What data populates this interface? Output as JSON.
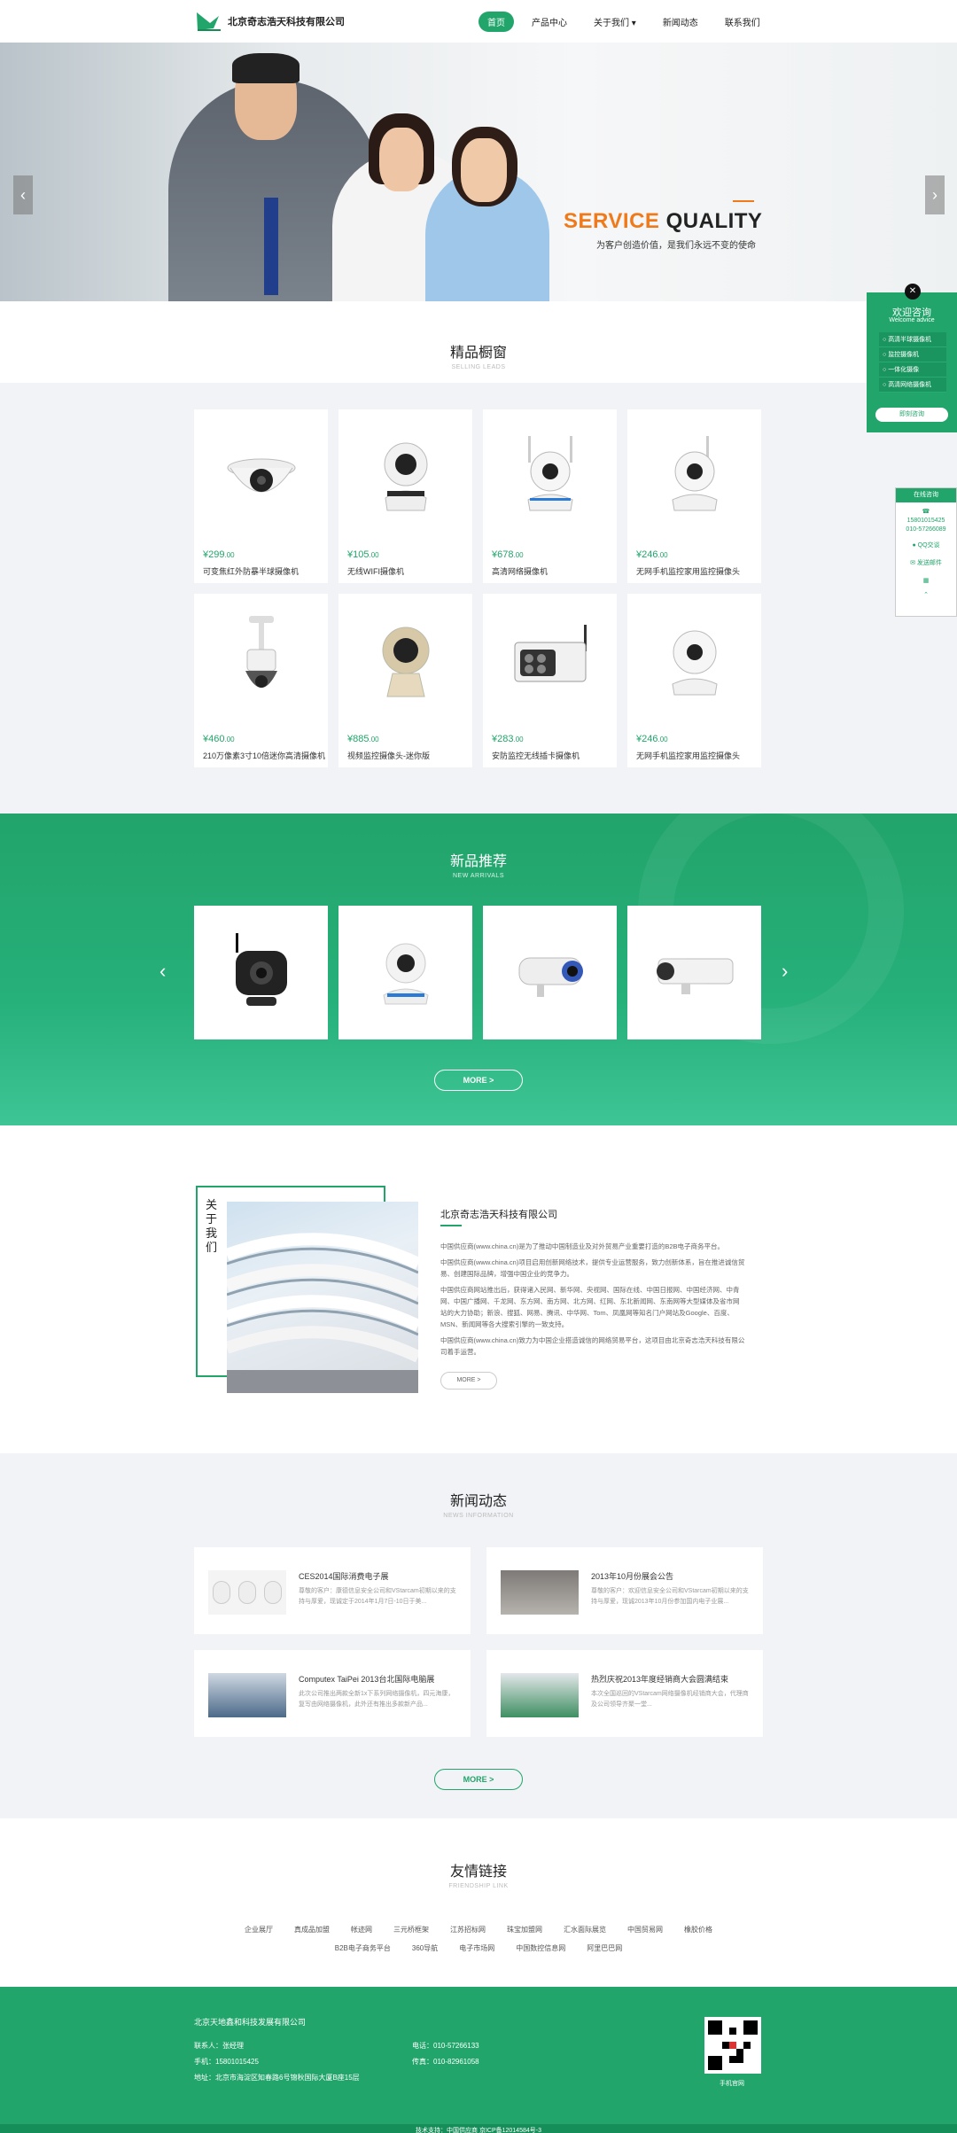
{
  "header": {
    "company": "北京奇志浩天科技有限公司",
    "nav": [
      "首页",
      "产品中心",
      "关于我们",
      "新闻动态",
      "联系我们"
    ],
    "nav_active": 0
  },
  "banner": {
    "title_orange": "SERVICE",
    "title_dark": "QUALITY",
    "subtitle": "为客户创造价值，是我们永远不变的使命"
  },
  "products": {
    "title": "精品橱窗",
    "subtitle": "SELLING LEADS",
    "items": [
      {
        "price": "¥299",
        "cents": ".00",
        "name": "可变焦红外防暴半球摄像机"
      },
      {
        "price": "¥105",
        "cents": ".00",
        "name": "无线WIFI摄像机"
      },
      {
        "price": "¥678",
        "cents": ".00",
        "name": "高清网络摄像机"
      },
      {
        "price": "¥246",
        "cents": ".00",
        "name": "无网手机监控家用监控摄像头"
      },
      {
        "price": "¥460",
        "cents": ".00",
        "name": "210万像素3寸10倍迷你高清摄像机"
      },
      {
        "price": "¥885",
        "cents": ".00",
        "name": "视频监控摄像头-迷你版"
      },
      {
        "price": "¥283",
        "cents": ".00",
        "name": "安防监控无线插卡摄像机"
      },
      {
        "price": "¥246",
        "cents": ".00",
        "name": "无网手机监控家用监控摄像头"
      }
    ]
  },
  "new_arrivals": {
    "title": "新品推荐",
    "subtitle": "NEW ARRIVALS",
    "more": "MORE >"
  },
  "about": {
    "label": "关于我们",
    "company": "北京奇志浩天科技有限公司",
    "paragraphs": [
      "中国供应商(www.china.cn)是为了推动中国制造业及对外贸易产业重要打造的B2B电子商务平台。",
      "中国供应商(www.china.cn)项目启用创新网络技术，提供专业运营服务，致力创新体系，旨在推进诚信贸易、创建国际品牌，增强中国企业的竞争力。",
      "中国供应商网站推出后，获得诸入民网、新华网、央视网、国际在线、中国日报网、中国经济网、中青网、中国广播网、千龙网、东方网、南方网、北方网、红网、东北新闻网、东南网等大型媒体及省市网站的大力协助；新浪、搜狐、网易、腾讯、中华网、Tom、凤凰网等知名门户网站及Google、百度、MSN、新闻网等各大搜索引擎的一致支持。",
      "中国供应商(www.china.cn)致力为中国企业搭造诚信的网络贸易平台，这项目由北京奇志浩天科技有限公司着手运营。"
    ],
    "more": "MORE >"
  },
  "news": {
    "title": "新闻动态",
    "subtitle": "NEWS INFORMATION",
    "items": [
      {
        "title": "CES2014国际消费电子展",
        "desc": "尊敬的客户：康德信息安全公司和VStarcam初期以来的支持与厚爱，现诚定于2014年1月7日-10日于美..."
      },
      {
        "title": "2013年10月份展会公告",
        "desc": "尊敬的客户：欢迎信息安全公司和VStarcam初期以来的支持与厚爱，现诚2013年10月份参加国内电子业展..."
      },
      {
        "title": "Computex TaiPei 2013台北国际电脑展",
        "desc": "此次公司推出两款全新1x下系列网络摄像机，四元海康，复写由网络摄像机，此外还有推出多款新产品..."
      },
      {
        "title": "热烈庆祝2013年度经销商大会圆满结束",
        "desc": "本次全国巡回的VStarcam网络摄像机经销商大会，代理商及公司领导齐聚一堂..."
      }
    ],
    "more": "MORE >"
  },
  "links": {
    "title": "友情链接",
    "subtitle": "FRIENDSHIP LINK",
    "row1": [
      "企业展厅",
      "真成品加盟",
      "帐迹网",
      "三元桥框架",
      "江苏招标网",
      "珠宝加盟网",
      "汇水面际展览",
      "中国贸易网",
      "橡胶价格"
    ],
    "row2": [
      "B2B电子商务平台",
      "360导航",
      "电子市场网",
      "中国数控信息网",
      "阿里巴巴网"
    ]
  },
  "footer": {
    "company": "北京天地鑫和科技发展有限公司",
    "contact": "联系人：张经理",
    "mobile": "手机：15801015425",
    "address": "地址：北京市海淀区知春路6号锦秋国际大厦B座15层",
    "tel": "电话：010-57266133",
    "fax": "传真：010-82961058",
    "qr_label": "手机官网",
    "copyright": "技术支持：中国供应商   京ICP备12014584号-3"
  },
  "float_panel": {
    "title": "欢迎咨询",
    "subtitle": "Welcome advice",
    "items": [
      "高清半球摄像机",
      "监控摄像机",
      "一体化摄像",
      "高清网络摄像机"
    ],
    "button": "即刻咨询"
  },
  "online": {
    "title": "在线咨询",
    "phone1": "15801015425",
    "phone2": "010-57266089",
    "qq": "QQ交谈",
    "email": "发送邮件"
  },
  "colors": {
    "brand_green": "#21a56b",
    "accent_orange": "#f07a1a"
  }
}
